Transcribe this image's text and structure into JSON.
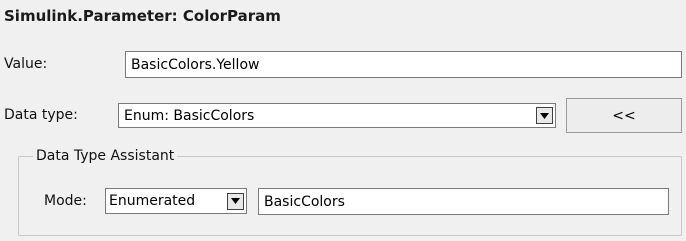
{
  "dialog": {
    "title": "Simulink.Parameter: ColorParam"
  },
  "value_row": {
    "label": "Value:",
    "value": "BasicColors.Yellow"
  },
  "datatype_row": {
    "label": "Data type:",
    "selected": "Enum: BasicColors",
    "assistant_button_label": "<<"
  },
  "assistant": {
    "legend": "Data Type Assistant",
    "mode_label": "Mode:",
    "mode_selected": "Enumerated",
    "class_value": "BasicColors"
  },
  "icons": {
    "dropdown": "chevron-down-icon"
  }
}
